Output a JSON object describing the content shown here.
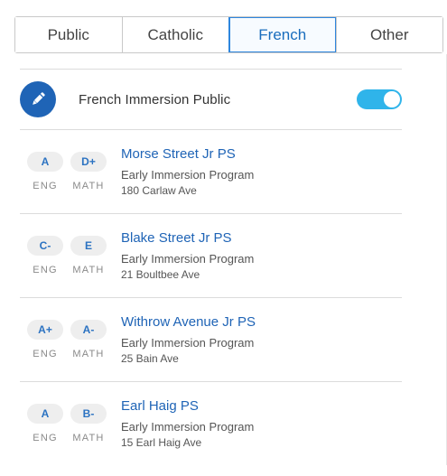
{
  "tabs": [
    {
      "label": "Public",
      "active": false
    },
    {
      "label": "Catholic",
      "active": false
    },
    {
      "label": "French",
      "active": true
    },
    {
      "label": "Other",
      "active": false
    }
  ],
  "filter": {
    "icon": "pencil-icon",
    "label": "French Immersion Public",
    "toggle_on": true
  },
  "schools": [
    {
      "name": "Morse Street Jr PS",
      "program": "Early Immersion Program",
      "address": "180 Carlaw Ave",
      "eng_grade": "A",
      "math_grade": "D+",
      "eng_label": "ENG",
      "math_label": "MATH"
    },
    {
      "name": "Blake Street Jr PS",
      "program": "Early Immersion Program",
      "address": "21 Boultbee Ave",
      "eng_grade": "C-",
      "math_grade": "E",
      "eng_label": "ENG",
      "math_label": "MATH"
    },
    {
      "name": "Withrow Avenue Jr PS",
      "program": "Early Immersion Program",
      "address": "25 Bain Ave",
      "eng_grade": "A+",
      "math_grade": "A-",
      "eng_label": "ENG",
      "math_label": "MATH"
    },
    {
      "name": "Earl Haig PS",
      "program": "Early Immersion Program",
      "address": "15 Earl Haig Ave",
      "eng_grade": "A",
      "math_grade": "B-",
      "eng_label": "ENG",
      "math_label": "MATH"
    }
  ],
  "colors": {
    "accent": "#1f64b6",
    "toggle": "#2fb4ea",
    "grade_pill": "#eeeeee"
  }
}
